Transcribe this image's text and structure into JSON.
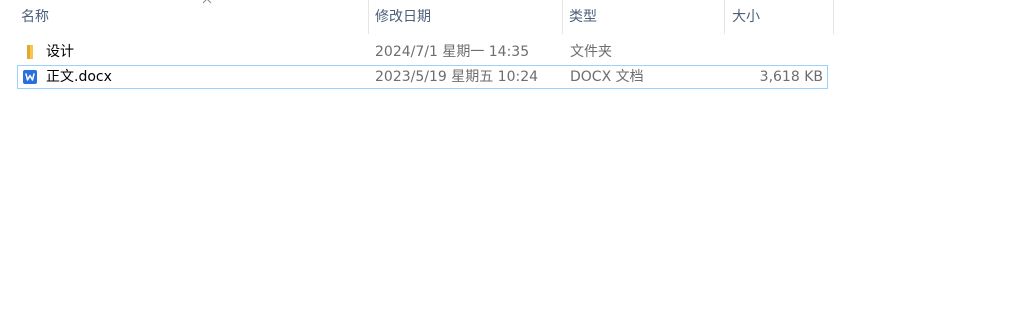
{
  "columns": {
    "name": "名称",
    "date_modified": "修改日期",
    "type": "类型",
    "size": "大小",
    "sort_indicator": "ascending"
  },
  "files": [
    {
      "name": "设计",
      "date_modified": "2024/7/1 星期一 14:35",
      "type": "文件夹",
      "size": "",
      "icon": "folder-icon"
    },
    {
      "name": "正文.docx",
      "date_modified": "2023/5/19 星期五 10:24",
      "type": "DOCX 文档",
      "size": "3,618 KB",
      "icon": "docx-icon",
      "focused": true
    }
  ],
  "colors": {
    "header_text": "#4c607a",
    "detail_text": "#6d6d6d",
    "focus_border": "#99d1ff",
    "folder": "#f8c64a",
    "docx_blue": "#2a6fdb"
  }
}
